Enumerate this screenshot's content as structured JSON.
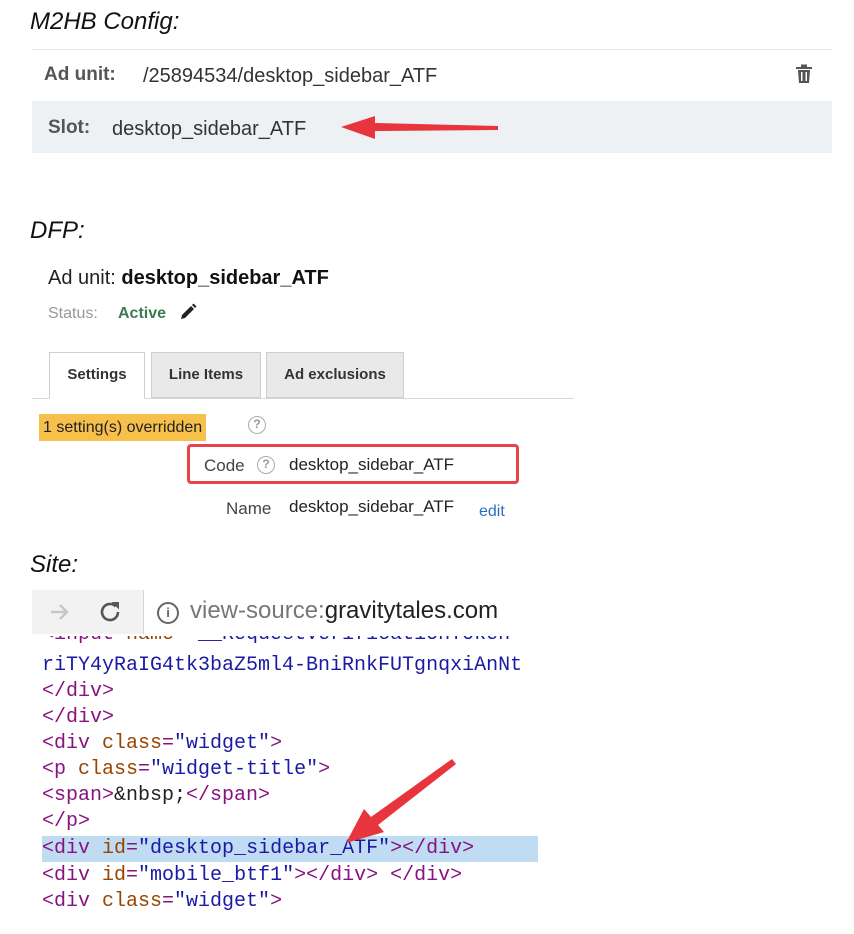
{
  "m2hb": {
    "heading": "M2HB Config:",
    "ad_unit_label": "Ad unit:",
    "ad_unit_value": "/25894534/desktop_sidebar_ATF",
    "slot_label": "Slot:",
    "slot_value": "desktop_sidebar_ATF"
  },
  "dfp": {
    "heading": "DFP:",
    "ad_unit_prefix": "Ad unit:",
    "ad_unit_name": "desktop_sidebar_ATF",
    "status_label": "Status:",
    "status_value": "Active",
    "tabs": [
      {
        "label": "Settings",
        "active": true
      },
      {
        "label": "Line Items",
        "active": false
      },
      {
        "label": "Ad exclusions",
        "active": false
      }
    ],
    "override_badge": "1 setting(s) overridden",
    "code_label": "Code",
    "code_value": "desktop_sidebar_ATF",
    "name_label": "Name",
    "name_value": "desktop_sidebar_ATF",
    "edit_link": "edit"
  },
  "site": {
    "heading": "Site:",
    "url_prefix": "view-source:",
    "url_host": "gravitytales.com",
    "source_lines": [
      "riTY4yRaIG4tk3baZ5ml4-BniRnkFUTgnqxiAnNt"
    ]
  },
  "colors": {
    "arrow": "#e8343c",
    "highlight_box": "#e8434a",
    "override_badge": "#f6c04a",
    "status_active": "#3d7a52",
    "line_highlight": "#bfdcf3"
  }
}
